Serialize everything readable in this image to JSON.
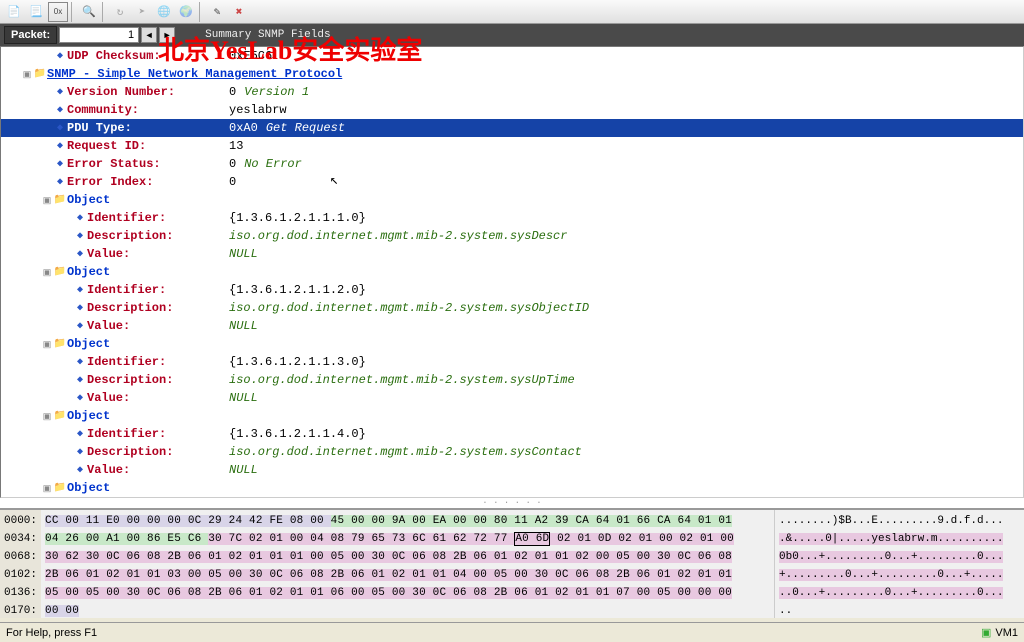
{
  "watermark": "北京YesLab安全实验室",
  "toolbar": {
    "icons": [
      "doc",
      "doc2",
      "hex",
      "|",
      "search",
      "|",
      "refresh",
      "arrow",
      "globe",
      "globe2",
      "|",
      "wand",
      "x"
    ]
  },
  "packetbar": {
    "label": "Packet:",
    "value": "1",
    "summary": "Summary SNMP Fields"
  },
  "tree": [
    {
      "ind": 2,
      "type": "attr",
      "label": "UDP Checksum:",
      "valn": "0xE5C6"
    },
    {
      "ind": 1,
      "type": "section",
      "exp": "-",
      "label": "SNMP - Simple Network Management Protocol",
      "ul": true
    },
    {
      "ind": 2,
      "type": "attr",
      "label": "Version Number:",
      "valn": "0",
      "val": "Version 1"
    },
    {
      "ind": 2,
      "type": "attr",
      "label": "Community:",
      "valn": "yeslabrw"
    },
    {
      "ind": 2,
      "type": "attr",
      "label": "PDU Type:",
      "valn": "0xA0",
      "val": "Get Request",
      "sel": true
    },
    {
      "ind": 2,
      "type": "attr",
      "label": "Request ID:",
      "valn": "13"
    },
    {
      "ind": 2,
      "type": "attr",
      "label": "Error Status:",
      "valn": "0",
      "val": "No Error"
    },
    {
      "ind": 2,
      "type": "attr",
      "label": "Error Index:",
      "valn": "0"
    },
    {
      "ind": 2,
      "type": "section",
      "exp": "-",
      "label": "Object"
    },
    {
      "ind": 3,
      "type": "attr",
      "label": "Identifier:",
      "valn": "{1.3.6.1.2.1.1.1.0}"
    },
    {
      "ind": 3,
      "type": "attr",
      "label": "Description:",
      "val": "iso.org.dod.internet.mgmt.mib-2.system.sysDescr"
    },
    {
      "ind": 3,
      "type": "attr",
      "label": "Value:",
      "val": "NULL"
    },
    {
      "ind": 2,
      "type": "section",
      "exp": "-",
      "label": "Object"
    },
    {
      "ind": 3,
      "type": "attr",
      "label": "Identifier:",
      "valn": "{1.3.6.1.2.1.1.2.0}"
    },
    {
      "ind": 3,
      "type": "attr",
      "label": "Description:",
      "val": "iso.org.dod.internet.mgmt.mib-2.system.sysObjectID"
    },
    {
      "ind": 3,
      "type": "attr",
      "label": "Value:",
      "val": "NULL"
    },
    {
      "ind": 2,
      "type": "section",
      "exp": "-",
      "label": "Object"
    },
    {
      "ind": 3,
      "type": "attr",
      "label": "Identifier:",
      "valn": "{1.3.6.1.2.1.1.3.0}"
    },
    {
      "ind": 3,
      "type": "attr",
      "label": "Description:",
      "val": "iso.org.dod.internet.mgmt.mib-2.system.sysUpTime"
    },
    {
      "ind": 3,
      "type": "attr",
      "label": "Value:",
      "val": "NULL"
    },
    {
      "ind": 2,
      "type": "section",
      "exp": "-",
      "label": "Object"
    },
    {
      "ind": 3,
      "type": "attr",
      "label": "Identifier:",
      "valn": "{1.3.6.1.2.1.1.4.0}"
    },
    {
      "ind": 3,
      "type": "attr",
      "label": "Description:",
      "val": "iso.org.dod.internet.mgmt.mib-2.system.sysContact"
    },
    {
      "ind": 3,
      "type": "attr",
      "label": "Value:",
      "val": "NULL"
    },
    {
      "ind": 2,
      "type": "section",
      "exp": "-",
      "label": "Object"
    }
  ],
  "hex": {
    "offsets": [
      "0000:",
      "0034:",
      "0068:",
      "0102:",
      "0136:",
      "0170:"
    ],
    "rows": [
      [
        {
          "t": "CC 00 11 E0 00 00 00 0C 29 24 42 FE 08 00 ",
          "c": "norm"
        },
        {
          "t": "45 00 00 9A 00 EA 00 00 80 11 A2 39 CA 64 01 66 CA 64 01 01",
          "c": "green"
        }
      ],
      [
        {
          "t": "04 26 00 A1 00 86 E5 C6 ",
          "c": "green"
        },
        {
          "t": "30 7C 02 01 00 04 08 79 65 73 6C 61 62 72 77 ",
          "c": "pink"
        },
        {
          "t": "A0 6D",
          "c": "pink",
          "box": true
        },
        {
          "t": " 02 01 0D 02 01 00 02 01 00",
          "c": "pink"
        }
      ],
      [
        {
          "t": "30 62 30 0C 06 08 2B 06 01 02 01 01 01 00 05 00 30 0C 06 08 2B 06 01 02 01 01 02 00 05 00 30 0C 06 08",
          "c": "pink"
        }
      ],
      [
        {
          "t": "2B 06 01 02 01 01 03 00 05 00 30 0C 06 08 2B 06 01 02 01 01 04 00 05 00 30 0C 06 08 2B 06 01 02 01 01",
          "c": "pink"
        }
      ],
      [
        {
          "t": "05 00 05 00 30 0C 06 08 2B 06 01 02 01 01 06 00 05 00 30 0C 06 08 2B 06 01 02 01 01 07 00 05 00 00 00",
          "c": "pink"
        }
      ],
      [
        {
          "t": "00 00",
          "c": "norm"
        }
      ]
    ],
    "ascii": [
      "........)$B...E.........9.d.f.d...",
      ".&.....0|.....yeslabrw.m..........",
      "0b0...+.........0...+.........0...",
      "+.........0...+.........0...+.....",
      "..0...+.........0...+.........0...",
      ".."
    ]
  },
  "status": {
    "help": "For Help, press F1",
    "vm": "VM1"
  }
}
